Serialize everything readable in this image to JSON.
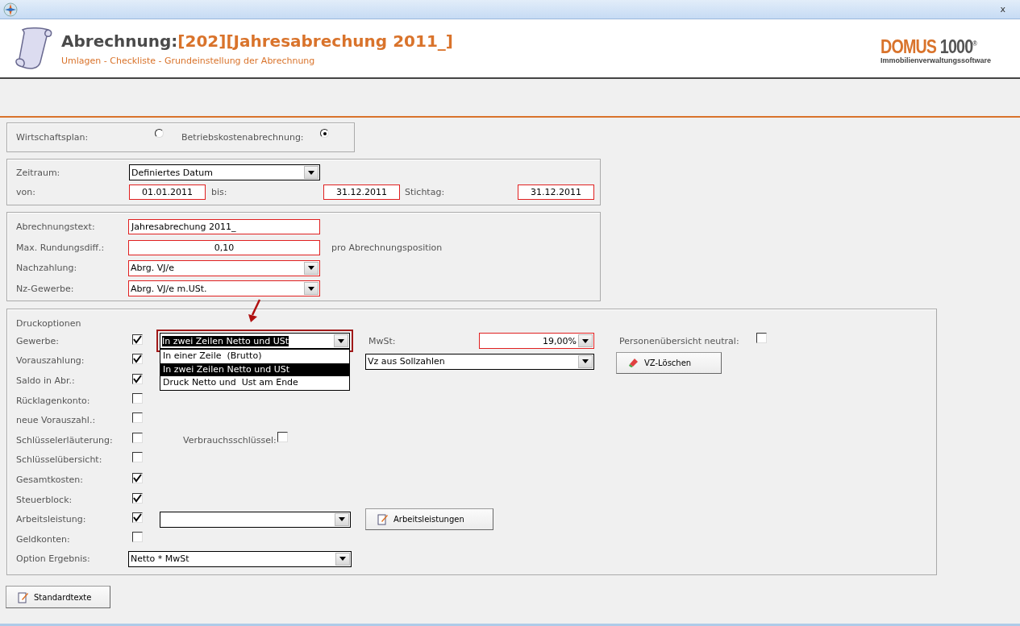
{
  "window": {
    "close": "x"
  },
  "header": {
    "title": "Abrechnung:",
    "reference": "[202][Jahresabrechung 2011_]",
    "subtitle": "Umlagen - Checkliste - Grundeinstellung der Abrechnung",
    "logo": {
      "brand": "DOMUS",
      "number": "1000",
      "mark": "®",
      "tagline": "Immobilienverwaltungssoftware"
    }
  },
  "mode": {
    "options": [
      {
        "label": "Wirtschaftsplan:",
        "selected": false
      },
      {
        "label": "Betriebskostenabrechnung:",
        "selected": true
      }
    ]
  },
  "period": {
    "zeitraum": {
      "label": "Zeitraum:",
      "value": "Definiertes Datum",
      "flagged": false
    },
    "von": {
      "label": "von:",
      "value": "01.01.2011",
      "flagged": true
    },
    "bis": {
      "label": "bis:",
      "value": "31.12.2011",
      "flagged": true
    },
    "stichtag": {
      "label": "Stichtag:",
      "value": "31.12.2011",
      "flagged": true
    }
  },
  "settings": {
    "rows": [
      {
        "kind": "text",
        "label": "Abrechnungstext:",
        "value": "Jahresabrechung 2011_",
        "flagged": true
      },
      {
        "kind": "number",
        "label": "Max. Rundungsdiff.:",
        "value": "0,10",
        "flagged": true,
        "note": "pro Abrechnungsposition"
      },
      {
        "kind": "select",
        "label": "Nachzahlung:",
        "value": "Abrg. VJ/e",
        "flagged": true
      },
      {
        "kind": "select",
        "label": "Nz-Gewerbe:",
        "value": "Abrg. VJ/e m.USt.",
        "flagged": true
      }
    ]
  },
  "print_options": {
    "title": "Druckoptionen",
    "options": [
      {
        "label": "Gewerbe:",
        "checked": true
      },
      {
        "label": "Vorauszahlung:",
        "checked": true
      },
      {
        "label": "Saldo in Abr.:",
        "checked": true
      },
      {
        "label": "Rücklagenkonto:",
        "checked": false
      },
      {
        "label": "neue Vorauszahl.:",
        "checked": false
      },
      {
        "label": "Schlüsselerläuterung:",
        "checked": false
      },
      {
        "label": "Schlüsselübersicht:",
        "checked": false
      },
      {
        "label": "Gesamtkosten:",
        "checked": true
      },
      {
        "label": "Steuerblock:",
        "checked": true
      },
      {
        "label": "Arbeitsleistung:",
        "checked": true
      },
      {
        "label": "Geldkonten:",
        "checked": false
      }
    ],
    "gewerbe_select": {
      "value": "In zwei Zeilen Netto und USt",
      "expanded": true,
      "items": [
        {
          "label": "In einer Zeile  (Brutto)",
          "selected": false
        },
        {
          "label": "In zwei Zeilen Netto und USt",
          "selected": true
        },
        {
          "label": "Druck Netto und  Ust am Ende",
          "selected": false
        }
      ]
    },
    "mwst": {
      "label": "MwSt:",
      "value": "19,00%",
      "flagged": true
    },
    "neutral": {
      "label": "Personenübersicht neutral:",
      "checked": false
    },
    "vz_select": {
      "value": "Vz aus Sollzahlen"
    },
    "vz_button": "VZ-Löschen",
    "verbrauch": {
      "label": "Verbrauchsschlüssel:",
      "checked": false
    },
    "work_button": "Arbeitsleistungen",
    "result": {
      "label": "Option Ergebnis:",
      "value": "Netto * MwSt"
    }
  },
  "standard_button": "Standardtexte"
}
